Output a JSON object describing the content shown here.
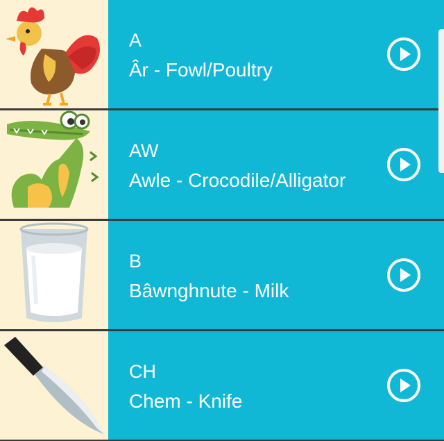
{
  "rows": [
    {
      "letter": "A",
      "word": "Âr - Fowl/Poultry",
      "icon": "rooster-icon"
    },
    {
      "letter": "AW",
      "word": "Awle - Crocodile/Alligator",
      "icon": "crocodile-icon"
    },
    {
      "letter": "B",
      "word": "Bâwnghnute - Milk",
      "icon": "glass-of-milk-icon"
    },
    {
      "letter": "CH",
      "word": "Chem - Knife",
      "icon": "knife-icon"
    }
  ],
  "play_icon": "play-circle-icon",
  "colors": {
    "row_bg": "#10b8d6",
    "thumb_bg": "#fdf2d3",
    "divider": "#3a3a3a",
    "text": "#ffffff"
  }
}
